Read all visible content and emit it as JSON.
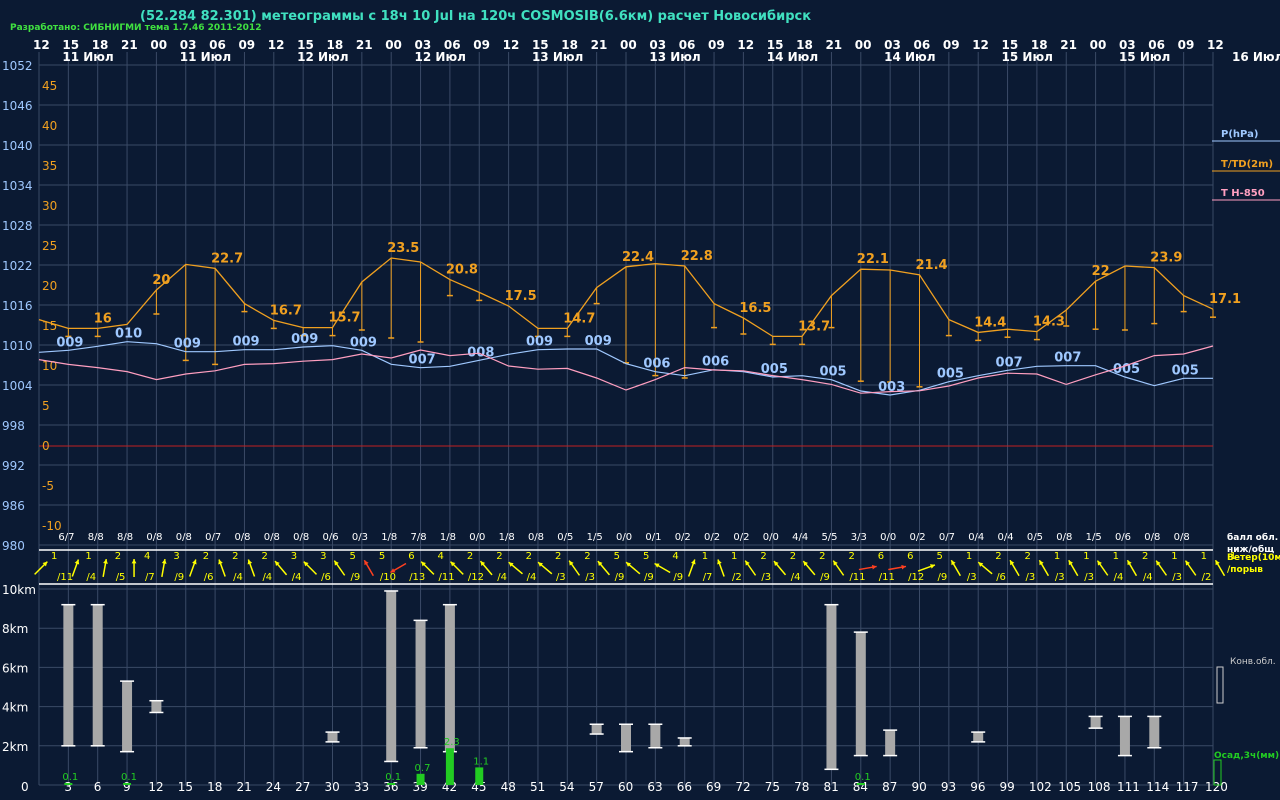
{
  "header": {
    "title": "(52.284 82.301) метеограммы с  18ч 10 Jul на 120ч COSMOSIB(6.6км) расчет Новосибирск",
    "credit": "Разработано: СИБНИГМИ тема 1.7.46 2011-2012"
  },
  "colors": {
    "background": "#0b1a33",
    "grid": "#3a4a66",
    "pressure": "#9fc8ff",
    "temperature": "#f0a020",
    "t850": "#ff9fc0",
    "precip": "#22cc22",
    "convcloud": "#a8a8a8",
    "wind": "#ffff00",
    "wind_strong": "#ff4020"
  },
  "time_axis": {
    "hours_top": [
      "12",
      "15",
      "18",
      "21",
      "00",
      "03",
      "06",
      "09",
      "12",
      "15",
      "18",
      "21",
      "00",
      "03",
      "06",
      "09",
      "12",
      "15",
      "18",
      "21",
      "00",
      "03",
      "06",
      "09",
      "12",
      "15",
      "18",
      "21",
      "00",
      "03",
      "06",
      "09",
      "12",
      "15",
      "18",
      "21",
      "00",
      "03",
      "06",
      "09",
      "12"
    ],
    "day_labels": [
      "11 Июл",
      "11 Июл",
      "12 Июл",
      "12 Июл",
      "13 Июл",
      "13 Июл",
      "14 Июл",
      "14 Июл",
      "15 Июл",
      "15 Июл",
      "16 Июл"
    ],
    "lead_hours": [
      "0",
      "3",
      "6",
      "9",
      "12",
      "15",
      "18",
      "21",
      "24",
      "27",
      "30",
      "33",
      "36",
      "39",
      "42",
      "45",
      "48",
      "51",
      "54",
      "57",
      "60",
      "63",
      "66",
      "69",
      "72",
      "75",
      "78",
      "81",
      "84",
      "87",
      "90",
      "93",
      "96",
      "99",
      "102",
      "105",
      "108",
      "111",
      "114",
      "117",
      "120"
    ]
  },
  "legend": {
    "pressure": "P(hPa)",
    "temperature": "T/TD(2m)",
    "t850": "T H-850",
    "cloud": "балл обл.\nниж/общ",
    "wind": "Ветер(10м)\n/порыв",
    "convcloud": "Конв.обл.",
    "precip": "Осад,3ч(мм)"
  },
  "chart_data": [
    {
      "type": "line",
      "title": "T/TD(2m), P(hPa), T H-850",
      "pressure_ticks": [
        "1052",
        "1046",
        "1040",
        "1034",
        "1028",
        "1022",
        "1016",
        "1010",
        "1004",
        "998",
        "992",
        "986",
        "980"
      ],
      "temp_ticks": [
        "45",
        "40",
        "35",
        "30",
        "25",
        "20",
        "15",
        "10",
        "5",
        "0",
        "-5",
        "-10"
      ],
      "x_hours": [
        0,
        3,
        6,
        9,
        12,
        15,
        18,
        21,
        24,
        27,
        30,
        33,
        36,
        39,
        42,
        45,
        48,
        51,
        54,
        57,
        60,
        63,
        66,
        69,
        72,
        75,
        78,
        81,
        84,
        87,
        90,
        93,
        96,
        99,
        102,
        105,
        108,
        111,
        114,
        117,
        120
      ],
      "temperature": [
        15.8,
        14.7,
        14.7,
        15.2,
        19.5,
        22.7,
        22.2,
        17.8,
        15.7,
        14.8,
        14.8,
        20.5,
        23.5,
        23.0,
        20.8,
        19.2,
        17.5,
        14.7,
        14.7,
        19.8,
        22.4,
        22.8,
        22.5,
        17.8,
        16.0,
        13.7,
        13.7,
        18.8,
        22.1,
        22.0,
        21.4,
        15.8,
        14.2,
        14.6,
        14.3,
        17.0,
        20.6,
        22.5,
        22.3,
        18.8,
        17.1
      ],
      "temperature_labels": [
        {
          "i": 2,
          "text": "16"
        },
        {
          "i": 4,
          "text": "20"
        },
        {
          "i": 6,
          "text": "22.7"
        },
        {
          "i": 8,
          "text": "16.7"
        },
        {
          "i": 10,
          "text": "15.7"
        },
        {
          "i": 12,
          "text": "23.5"
        },
        {
          "i": 14,
          "text": "20.8"
        },
        {
          "i": 16,
          "text": "17.5"
        },
        {
          "i": 18,
          "text": "14.7"
        },
        {
          "i": 20,
          "text": "22.4"
        },
        {
          "i": 22,
          "text": "22.8"
        },
        {
          "i": 24,
          "text": "16.5"
        },
        {
          "i": 26,
          "text": "13.7"
        },
        {
          "i": 28,
          "text": "22.1"
        },
        {
          "i": 30,
          "text": "21.4"
        },
        {
          "i": 32,
          "text": "14.4"
        },
        {
          "i": 34,
          "text": "14.3"
        },
        {
          "i": 36,
          "text": "22"
        },
        {
          "i": 38,
          "text": "23.9"
        },
        {
          "i": 40,
          "text": "17.1"
        }
      ],
      "dewpoint_depth": [
        0,
        1,
        1,
        0,
        3,
        12,
        12,
        1,
        1,
        1,
        1,
        6,
        10,
        10,
        2,
        1,
        0,
        1,
        1,
        2,
        12,
        14,
        14,
        3,
        2,
        1,
        1,
        4,
        14,
        14,
        14,
        2,
        1,
        1,
        1,
        2,
        6,
        8,
        7,
        2,
        1
      ],
      "pressure": [
        1008.9,
        1009.2,
        1009.8,
        1010.5,
        1010.2,
        1009.0,
        1009.0,
        1009.3,
        1009.3,
        1009.7,
        1009.9,
        1009.2,
        1007.1,
        1006.6,
        1006.8,
        1007.7,
        1008.6,
        1009.3,
        1009.4,
        1009.4,
        1007.2,
        1006.0,
        1005.4,
        1006.3,
        1006.0,
        1005.2,
        1005.4,
        1004.8,
        1003.1,
        1002.5,
        1003.2,
        1004.5,
        1005.4,
        1006.2,
        1006.8,
        1006.9,
        1006.9,
        1005.2,
        1003.9,
        1005.0,
        1005.0
      ],
      "pressure_labels": [
        {
          "i": 1,
          "text": "009"
        },
        {
          "i": 3,
          "text": "010"
        },
        {
          "i": 5,
          "text": "009"
        },
        {
          "i": 7,
          "text": "009"
        },
        {
          "i": 9,
          "text": "009"
        },
        {
          "i": 11,
          "text": "009"
        },
        {
          "i": 13,
          "text": "007"
        },
        {
          "i": 15,
          "text": "008"
        },
        {
          "i": 17,
          "text": "009"
        },
        {
          "i": 19,
          "text": "009"
        },
        {
          "i": 21,
          "text": "006"
        },
        {
          "i": 23,
          "text": "006"
        },
        {
          "i": 25,
          "text": "005"
        },
        {
          "i": 27,
          "text": "005"
        },
        {
          "i": 29,
          "text": "003"
        },
        {
          "i": 31,
          "text": "005"
        },
        {
          "i": 33,
          "text": "007"
        },
        {
          "i": 35,
          "text": "007"
        },
        {
          "i": 37,
          "text": "005"
        },
        {
          "i": 39,
          "text": "005"
        }
      ],
      "t850": [
        10.8,
        10.2,
        9.8,
        9.3,
        8.3,
        9.0,
        9.4,
        10.2,
        10.3,
        10.6,
        10.8,
        11.5,
        11.0,
        12.0,
        11.3,
        11.6,
        10.0,
        9.6,
        9.7,
        8.5,
        7.0,
        8.3,
        9.8,
        9.5,
        9.4,
        8.8,
        8.3,
        7.7,
        6.6,
        6.8,
        6.9,
        7.5,
        8.5,
        9.1,
        9.0,
        7.7,
        8.9,
        10.0,
        11.3,
        11.5,
        12.5
      ]
    },
    {
      "type": "table",
      "title": "балл обл. ниж/общ",
      "cloud_cover": [
        "6/7",
        "8/8",
        "8/8",
        "0/8",
        "0/8",
        "0/7",
        "0/8",
        "0/8",
        "0/8",
        "0/6",
        "0/3",
        "1/8",
        "7/8",
        "1/8",
        "0/0",
        "1/8",
        "0/8",
        "0/5",
        "1/5",
        "0/0",
        "0/1",
        "0/2",
        "0/2",
        "0/2",
        "0/0",
        "4/4",
        "5/5",
        "3/3",
        "0/0",
        "0/2",
        "0/7",
        "0/4",
        "0/4",
        "0/5",
        "0/8",
        "1/5",
        "0/6",
        "0/8",
        "0/8"
      ],
      "wind_speed": [
        "1",
        "1",
        "2",
        "4",
        "3",
        "2",
        "2",
        "2",
        "3",
        "3",
        "5",
        "5",
        "6",
        "4",
        "2",
        "2",
        "2",
        "2",
        "2",
        "5",
        "5",
        "4",
        "1",
        "1",
        "2",
        "2",
        "2",
        "2",
        "6",
        "6",
        "5",
        "1",
        "2",
        "2",
        "1",
        "1",
        "1",
        "2",
        "1",
        "1",
        "1"
      ],
      "wind_gust": [
        "/11",
        "/4",
        "/5",
        "/7",
        "/9",
        "/6",
        "/4",
        "/4",
        "/4",
        "/6",
        "/9",
        "/10",
        "/13",
        "/11",
        "/12",
        "/4",
        "/4",
        "/3",
        "/3",
        "/9",
        "/9",
        "/9",
        "/7",
        "/2",
        "/3",
        "/4",
        "/9",
        "/11",
        "/11",
        "/12",
        "/9",
        "/3",
        "/6",
        "/3",
        "/3",
        "/3",
        "/4",
        "/4",
        "/3",
        "/2"
      ],
      "wind_dir_deg": [
        135,
        160,
        170,
        180,
        170,
        160,
        200,
        200,
        220,
        225,
        215,
        210,
        300,
        225,
        225,
        220,
        230,
        230,
        215,
        220,
        230,
        240,
        160,
        200,
        215,
        220,
        220,
        215,
        100,
        100,
        110,
        210,
        230,
        210,
        210,
        210,
        215,
        210,
        215,
        215,
        210
      ],
      "wind_strong": [
        false,
        false,
        false,
        false,
        false,
        false,
        false,
        false,
        false,
        false,
        false,
        true,
        true,
        false,
        false,
        false,
        false,
        false,
        false,
        false,
        false,
        false,
        false,
        false,
        false,
        false,
        false,
        false,
        true,
        true,
        false,
        false,
        false,
        false,
        false,
        false,
        false,
        false,
        false,
        false,
        false
      ]
    },
    {
      "type": "bar",
      "title": "Конв.обл. / Осад,3ч(мм)",
      "height_ticks": [
        "10km",
        "8km",
        "6km",
        "4km",
        "2km"
      ],
      "conv_cloud": [
        {
          "i": 1,
          "base": 2.0,
          "top": 9.2
        },
        {
          "i": 2,
          "base": 2.0,
          "top": 9.2
        },
        {
          "i": 3,
          "base": 1.7,
          "top": 5.3
        },
        {
          "i": 4,
          "base": 3.7,
          "top": 4.3
        },
        {
          "i": 10,
          "base": 2.2,
          "top": 2.7
        },
        {
          "i": 12,
          "base": 1.2,
          "top": 9.9
        },
        {
          "i": 13,
          "base": 1.9,
          "top": 8.4
        },
        {
          "i": 14,
          "base": 1.7,
          "top": 9.2
        },
        {
          "i": 19,
          "base": 2.6,
          "top": 3.1
        },
        {
          "i": 20,
          "base": 1.7,
          "top": 3.1
        },
        {
          "i": 21,
          "base": 1.9,
          "top": 3.1
        },
        {
          "i": 22,
          "base": 2.0,
          "top": 2.4
        },
        {
          "i": 27,
          "base": 0.8,
          "top": 9.2
        },
        {
          "i": 28,
          "base": 1.5,
          "top": 7.8
        },
        {
          "i": 29,
          "base": 1.5,
          "top": 2.8
        },
        {
          "i": 32,
          "base": 2.2,
          "top": 2.7
        },
        {
          "i": 36,
          "base": 2.9,
          "top": 3.5
        },
        {
          "i": 37,
          "base": 1.5,
          "top": 3.5
        },
        {
          "i": 38,
          "base": 1.9,
          "top": 3.5
        }
      ],
      "precip": [
        {
          "i": 1,
          "value": 0.1,
          "text": "0.1"
        },
        {
          "i": 3,
          "value": 0.1,
          "text": "0.1"
        },
        {
          "i": 12,
          "value": 0.1,
          "text": "0.1"
        },
        {
          "i": 13,
          "value": 0.7,
          "text": "0.7"
        },
        {
          "i": 14,
          "value": 2.3,
          "text": "2.3"
        },
        {
          "i": 15,
          "value": 1.1,
          "text": "1.1"
        },
        {
          "i": 28,
          "value": 0.1,
          "text": "0.1"
        }
      ]
    }
  ]
}
